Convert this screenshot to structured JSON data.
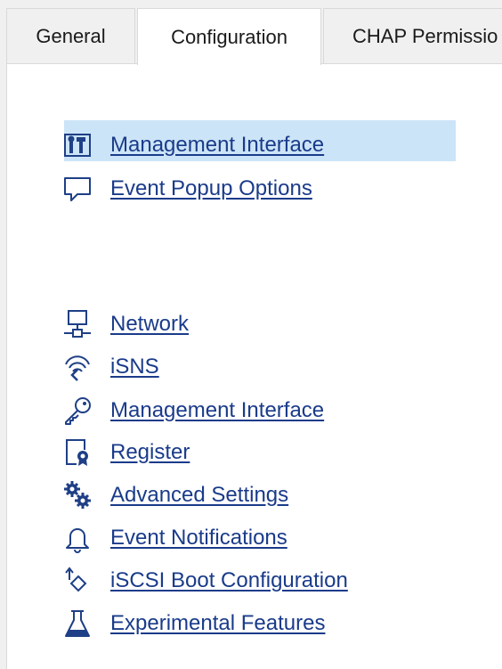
{
  "tabs": [
    {
      "label": "General"
    },
    {
      "label": "Configuration"
    },
    {
      "label": "CHAP Permissio"
    }
  ],
  "top_links": [
    {
      "label": "Management Interface",
      "icon": "tools-icon"
    },
    {
      "label": "Event Popup Options",
      "icon": "speech-bubble-icon"
    }
  ],
  "links": [
    {
      "label": "Network",
      "icon": "network-icon"
    },
    {
      "label": "iSNS",
      "icon": "isns-wifi-icon"
    },
    {
      "label": "Management Interface",
      "icon": "key-icon"
    },
    {
      "label": "Register",
      "icon": "register-certificate-icon"
    },
    {
      "label": "Advanced Settings",
      "icon": "gears-icon"
    },
    {
      "label": "Event Notifications",
      "icon": "bell-icon"
    },
    {
      "label": "iSCSI Boot Configuration",
      "icon": "boot-arrow-icon"
    },
    {
      "label": "Experimental Features",
      "icon": "flask-icon"
    }
  ],
  "colors": {
    "link": "#1a3b8a",
    "selection": "#cce4f7",
    "icon": "#1f3f86"
  }
}
